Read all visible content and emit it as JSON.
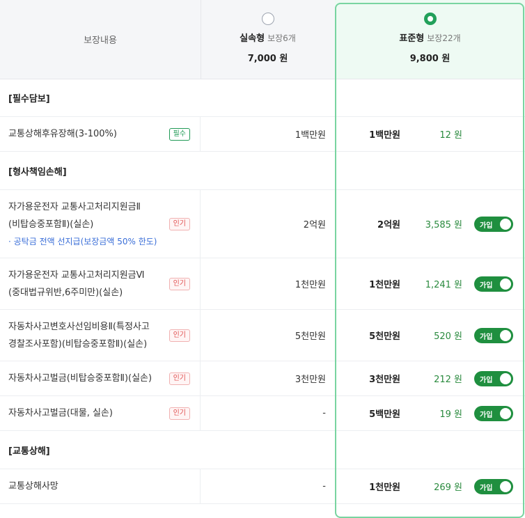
{
  "header": {
    "coverage_label": "보장내용",
    "plan_basic": {
      "name": "실속형",
      "count": "보장6개",
      "price": "7,000 원",
      "selected": false
    },
    "plan_standard": {
      "name": "표준형",
      "count": "보장22개",
      "price": "9,800 원",
      "selected": true
    }
  },
  "sections": [
    {
      "title": "[필수담보]"
    },
    {
      "title": "[형사책임손해]"
    },
    {
      "title": "[교통상해]"
    }
  ],
  "rows": [
    {
      "name_lines": [
        "교통상해후유장해(3-100%)"
      ],
      "badge": "필수",
      "basic": "1백만원",
      "standard": "1백만원",
      "price": "12 원",
      "toggle": ""
    },
    {
      "name_lines": [
        "자가용운전자 교통사고처리지원금Ⅱ",
        "(비탑승중포함Ⅱ)(실손)"
      ],
      "note": "· 공탁금 전액 선지급(보장금액 50% 한도)",
      "badge": "인기",
      "basic": "2억원",
      "standard": "2억원",
      "price": "3,585 원",
      "toggle": "가입"
    },
    {
      "name_lines": [
        "자가용운전자 교통사고처리지원금Ⅵ",
        "(중대법규위반,6주미만)(실손)"
      ],
      "badge": "인기",
      "basic": "1천만원",
      "standard": "1천만원",
      "price": "1,241 원",
      "toggle": "가입"
    },
    {
      "name_lines": [
        "자동차사고변호사선임비용Ⅱ(특정사고",
        "경찰조사포함)(비탑승중포함Ⅱ)(실손)"
      ],
      "badge": "인기",
      "basic": "5천만원",
      "standard": "5천만원",
      "price": "520 원",
      "toggle": "가입"
    },
    {
      "name_lines": [
        "자동차사고벌금(비탑승중포함Ⅱ)(실손)"
      ],
      "badge": "인기",
      "basic": "3천만원",
      "standard": "3천만원",
      "price": "212 원",
      "toggle": "가입"
    },
    {
      "name_lines": [
        "자동차사고벌금(대물, 실손)"
      ],
      "badge": "인기",
      "basic": "-",
      "standard": "5백만원",
      "price": "19 원",
      "toggle": "가입"
    },
    {
      "name_lines": [
        "교통상해사망"
      ],
      "badge": "",
      "basic": "-",
      "standard": "1천만원",
      "price": "269 원",
      "toggle": "가입"
    }
  ],
  "colors": {
    "accent": "#1f8f3f",
    "selected_bg": "#eefaf3",
    "frame": "#78d4a0",
    "price": "#2a8a3e",
    "note": "#3b6fd8",
    "hot": "#e05252"
  }
}
